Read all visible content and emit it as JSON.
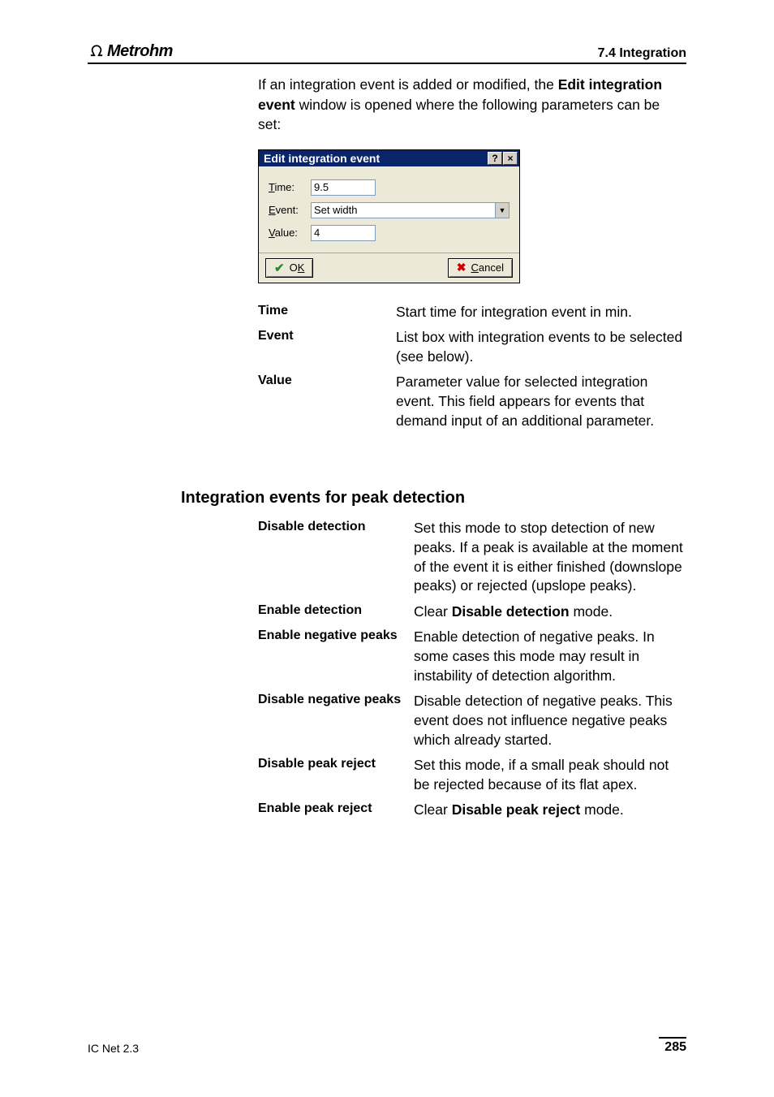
{
  "header": {
    "logo_text": "Metrohm",
    "section_ref": "7.4  Integration"
  },
  "intro": {
    "prefix": "If an integration event is added or modified, the ",
    "bold": "Edit integration event",
    "suffix": " window is opened where the following parameters can be set:"
  },
  "dialog": {
    "title": "Edit integration event",
    "help_btn": "?",
    "close_btn": "×",
    "time_label": "Time:",
    "time_value": "9.5",
    "event_label": "Event:",
    "event_value": "Set width",
    "value_label": "Value:",
    "value_value": "4",
    "ok_label": "OK",
    "cancel_label": "Cancel"
  },
  "defs1": [
    {
      "term": "Time",
      "desc_plain": "Start time for integration event in min."
    },
    {
      "term": "Event",
      "desc_plain": "List box with integration events to be selected (see below)."
    },
    {
      "term": "Value",
      "desc_plain": "Parameter value for selected integration event. This field appears for events that demand input of an additional parameter."
    }
  ],
  "section_title": "Integration events for peak detection",
  "defs2": [
    {
      "term": "Disable detection",
      "desc_plain": "Set this mode to stop detection of new peaks. If a peak is available at the moment of the event it is either finished (downslope peaks) or rejected (upslope peaks)."
    },
    {
      "term": "Enable detection",
      "desc_pre": "Clear ",
      "desc_bold": "Disable detection",
      "desc_post": " mode."
    },
    {
      "term": "Enable negative peaks",
      "desc_plain": "Enable detection of negative peaks. In some cases this mode may result in instability of detection algorithm."
    },
    {
      "term": "Disable negative peaks",
      "desc_plain": "Disable detection of negative peaks. This event does not influence negative peaks which already started."
    },
    {
      "term": "Disable peak reject",
      "desc_plain": "Set this mode, if a small peak should not be rejected because of its flat apex."
    },
    {
      "term": "Enable peak reject",
      "desc_pre": "Clear ",
      "desc_bold": "Disable peak reject",
      "desc_post": " mode."
    }
  ],
  "footer": {
    "left": "IC Net 2.3",
    "page": "285"
  }
}
